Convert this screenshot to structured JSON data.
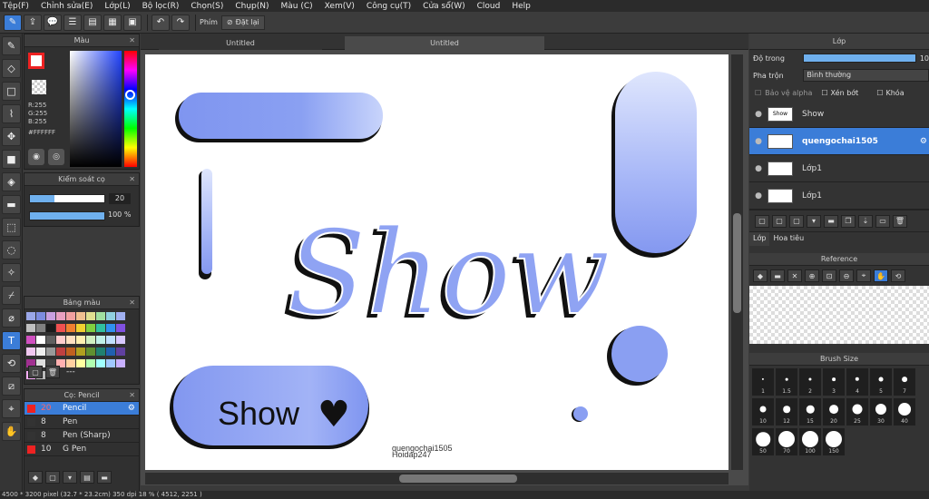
{
  "menu": [
    "Tệp(F)",
    "Chỉnh sửa(E)",
    "Lớp(L)",
    "Bộ lọc(R)",
    "Chọn(S)",
    "Chụp(N)",
    "Màu (C)",
    "Xem(V)",
    "Công cụ(T)",
    "Cửa sổ(W)",
    "Cloud",
    "Help"
  ],
  "toolbar": {
    "phim": "Phím",
    "dat_lai": "Đặt lại"
  },
  "tabs": [
    "Untitled",
    "Untitled"
  ],
  "color_panel": {
    "title": "Màu",
    "r": "R:255",
    "g": "G:255",
    "b": "B:255",
    "hex": "#FFFFFF"
  },
  "brush_control": {
    "title": "Kiểm soát cọ",
    "size": "20",
    "opacity": "100 %",
    "opacity_value": 100,
    "size_fraction": 0.33
  },
  "palette": {
    "title": "Bảng màu",
    "dash": "---",
    "colors": [
      "#9aa7e8",
      "#7d8ce0",
      "#c9a0e0",
      "#e8a0c0",
      "#f0a0a0",
      "#f0c090",
      "#e0e090",
      "#a0e0a0",
      "#90d0e0",
      "#a0b0f0",
      "#c0c0c0",
      "#808080",
      "#1a1a1a",
      "#f05050",
      "#f08030",
      "#f0d030",
      "#80d040",
      "#30c0a0",
      "#3090f0",
      "#8050e0",
      "#d050c0",
      "#ffffff",
      "#606060",
      "#ffcccc",
      "#ffe0c0",
      "#fff0b0",
      "#d0f0c0",
      "#c0f0e8",
      "#c0e0ff",
      "#d8c8ff",
      "#f0c8f0",
      "#eeeeee",
      "#999999",
      "#c04040",
      "#c06020",
      "#b0a020",
      "#609030",
      "#208070",
      "#2060b0",
      "#6040a0",
      "#a03090",
      "#dddddd",
      "#444444",
      "#ffb0b0",
      "#ffd0a0",
      "#ffffa0",
      "#b0ffb0",
      "#a0ffff",
      "#a0c8ff",
      "#c8b0ff",
      "#ffb0ff",
      "#bbbbbb"
    ]
  },
  "brush_panel": {
    "title": "Cọ: Pencil",
    "items": [
      {
        "size": "20",
        "name": "Pencil",
        "selected": true
      },
      {
        "size": "8",
        "name": "Pen"
      },
      {
        "size": "8",
        "name": "Pen (Sharp)"
      },
      {
        "size": "10",
        "name": "G Pen"
      }
    ]
  },
  "layers": {
    "title": "Lớp",
    "opacity_label": "Độ trong",
    "opacity_value": "10",
    "blend_label": "Pha trộn",
    "blend_value": "Bình thường",
    "protect_alpha": "Bảo vệ alpha",
    "clipping": "Xén bớt",
    "lock": "Khóa",
    "items": [
      {
        "name": "Show",
        "thumb": "Show"
      },
      {
        "name": "quengochai1505",
        "selected": true
      },
      {
        "name": "Lớp1"
      },
      {
        "name": "Lớp1"
      }
    ],
    "tab1": "Lớp",
    "tab2": "Hoa tiêu"
  },
  "reference": {
    "title": "Reference"
  },
  "brush_size": {
    "title": "Brush Size",
    "sizes": [
      "1",
      "1.5",
      "2",
      "3",
      "4",
      "5",
      "7",
      "10",
      "12",
      "15",
      "20",
      "25",
      "30",
      "40",
      "50",
      "70",
      "100",
      "150"
    ]
  },
  "canvas": {
    "show_big": "Show",
    "show_small": "Show",
    "heart": "♥",
    "signature1": "quengochai1505",
    "signature2": "Hoidap247"
  },
  "status": "4500 * 3200 pixel   (32.7 * 23.2cm)   350 dpi   18 %   ( 4512, 2251 )",
  "colors": {
    "accent": "#3b7dd8",
    "blob": "#8fa1ee"
  }
}
